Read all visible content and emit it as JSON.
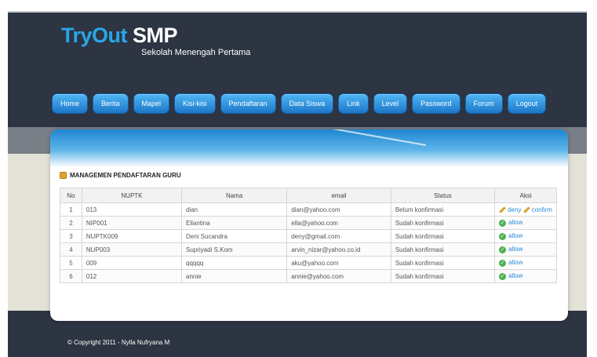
{
  "header": {
    "logo_main_1": "TryOut",
    "logo_main_2": "SMP",
    "logo_sub": "Sekolah Menengah Pertama"
  },
  "nav": {
    "items": [
      {
        "label": "Home"
      },
      {
        "label": "Berita"
      },
      {
        "label": "Mapel"
      },
      {
        "label": "Kisi-kisi"
      },
      {
        "label": "Pendaftaran"
      },
      {
        "label": "Data Siswa"
      },
      {
        "label": "Link"
      },
      {
        "label": "Level"
      },
      {
        "label": "Password"
      },
      {
        "label": "Forum"
      },
      {
        "label": "Logout"
      }
    ]
  },
  "main": {
    "section_title": "MANAGEMEN PENDAFTARAN GURU",
    "table": {
      "headers": [
        "No",
        "NUPTK",
        "Nama",
        "email",
        "Status",
        "Aksi"
      ],
      "rows": [
        {
          "no": "1",
          "nuptk": "013",
          "nama": "dian",
          "email": "dian@yahoo.com",
          "status": "Belum konfirmasi",
          "deny": "deny",
          "confirm": "confirm"
        },
        {
          "no": "2",
          "nuptk": "NIP001",
          "nama": "Ellantina",
          "email": "ella@yahoo.com",
          "status": "Sudah konfirmasi",
          "allow": "allow"
        },
        {
          "no": "3",
          "nuptk": "NUPTK009",
          "nama": "Deni Sucandra",
          "email": "deny@gmail.com",
          "status": "Sudah konfirmasi",
          "allow": "allow"
        },
        {
          "no": "4",
          "nuptk": "NUP003",
          "nama": "Supriyadi S.Kom",
          "email": "arvin_nizar@yahoo.co.id",
          "status": "Sudah konfirmasi",
          "allow": "allow"
        },
        {
          "no": "5",
          "nuptk": "009",
          "nama": "qqqqq",
          "email": "aku@yahoo.com",
          "status": "Sudah konfirmasi",
          "allow": "allow"
        },
        {
          "no": "6",
          "nuptk": "012",
          "nama": "annie",
          "email": "annie@yahoo.com",
          "status": "Sudah konfirmasi",
          "allow": "allow"
        }
      ]
    }
  },
  "footer": {
    "copyright": "© Copyright 2011 - Nylla Nufryana M"
  },
  "colors": {
    "background": "#2d3442",
    "accent": "#29a6e6",
    "button": "#1c77c8"
  }
}
